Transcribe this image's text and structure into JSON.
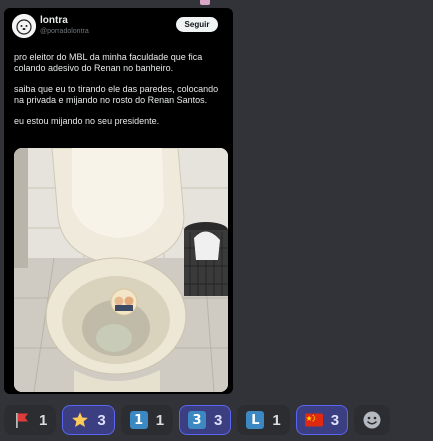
{
  "post": {
    "display_name": "lontra",
    "handle": "@porradolontra",
    "follow_label": "Seguir",
    "paragraphs": [
      "pro eleitor do MBL da minha faculdade que fica colando adesivo do Renan no banheiro.",
      "saiba que eu to tirando ele das paredes, colocando na privada e mijando no rosto do Renan Santos.",
      "eu estou mijando no seu presidente."
    ]
  },
  "reactions": [
    {
      "icon": "red-flag-icon",
      "count": "1",
      "active": false
    },
    {
      "icon": "star-icon",
      "count": "3",
      "active": true
    },
    {
      "icon": "keycap-1-icon",
      "glyph": "1",
      "count": "1",
      "active": false
    },
    {
      "icon": "keycap-3-icon",
      "glyph": "3",
      "count": "3",
      "active": true
    },
    {
      "icon": "letter-l-icon",
      "glyph": "L",
      "count": "1",
      "active": false
    },
    {
      "icon": "china-flag-icon",
      "count": "3",
      "active": true
    }
  ],
  "colors": {
    "background": "#313338",
    "card": "#000000",
    "reaction_active": "#3b3f82",
    "reaction_active_border": "#5865f2",
    "keycap_blue": "#3b88c3"
  }
}
